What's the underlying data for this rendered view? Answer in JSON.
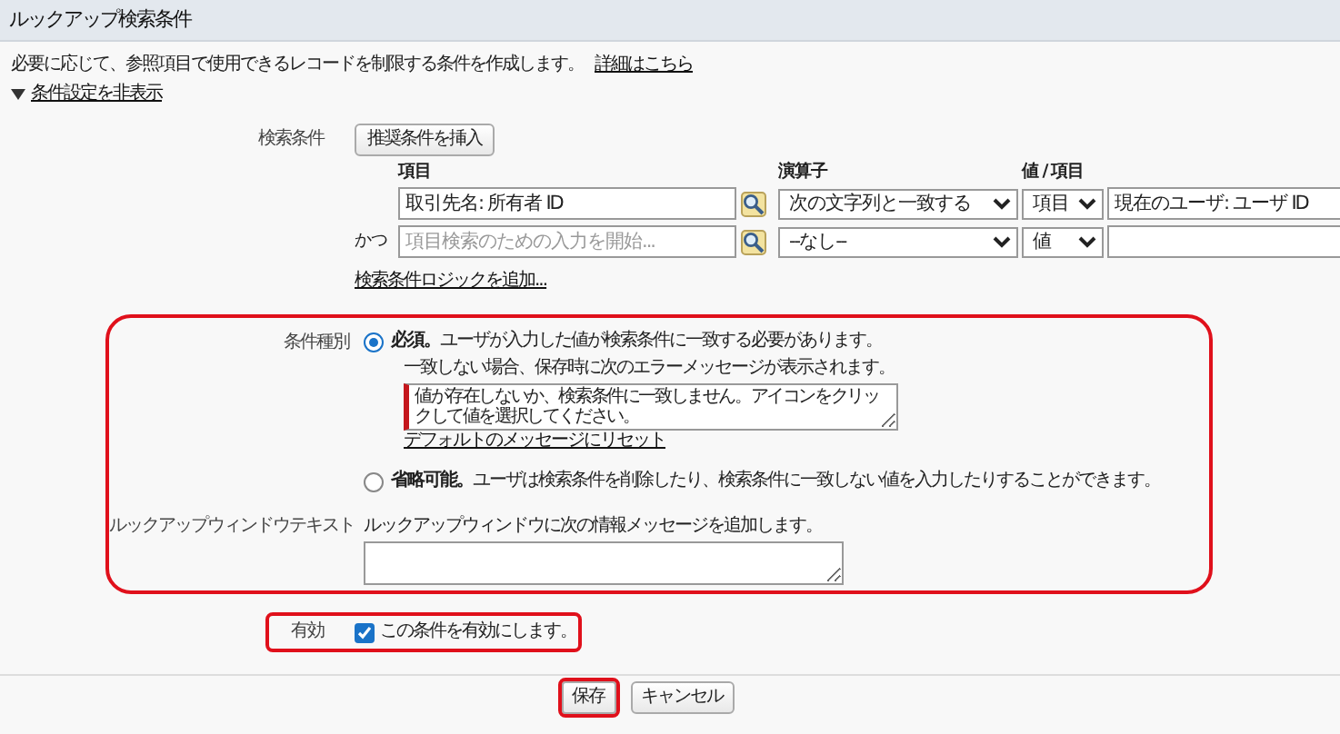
{
  "section_title": "ルックアップ検索条件",
  "description": "必要に応じて、参照項目で使用できるレコードを制限する条件を作成します。",
  "help_link": "詳細はこちら",
  "toggle": {
    "label": "条件設定を非表示",
    "expanded": true
  },
  "criteria": {
    "label": "検索条件",
    "insert_button": "推奨条件を挿入",
    "columns": [
      "項目",
      "演算子",
      "値 / 項目"
    ],
    "rows": [
      {
        "field": {
          "value": "取引先名: 所有者 ID"
        },
        "operator": "次の文字列と一致する",
        "value_type": "項目",
        "value": "現在のユーザ: ユーザ ID"
      },
      {
        "connector": "かつ",
        "field": {
          "placeholder": "項目検索のための入力を開始..."
        },
        "operator": "--なし--",
        "value_type": "値"
      }
    ],
    "logic_link": "検索条件ロジックを追加..."
  },
  "settings": {
    "highlighted": true,
    "filter_type": {
      "label": "条件種別",
      "options": [
        {
          "kind": "required",
          "text": "**必須。**ユーザが入力した値が検索条件に一致する必要があります。",
          "selected": true,
          "error_prompt": "一致しない場合、保存時に次のエラーメッセージが表示されます。",
          "error_message": "値が存在しないか、検索条件に一致しません。アイコンをクリックして値を選択してください。",
          "reset_link": "デフォルトのメッセージにリセット"
        },
        {
          "kind": "optional",
          "text": "**省略可能。**ユーザは検索条件を削除したり、検索条件に一致しない値を入力したりすることができます。",
          "selected": false
        }
      ]
    },
    "lookup_text": {
      "label": "ルックアップウィンドウテキスト",
      "prompt": "ルックアップウィンドウに次の情報メッセージを追加します。"
    }
  },
  "active": {
    "label": "有効",
    "highlighted": true,
    "checkbox_label": "この条件を有効にします。",
    "checked": true
  },
  "buttons": [
    {
      "label": "保存",
      "highlighted": true
    },
    {
      "label": "キャンセル",
      "highlighted": false
    }
  ]
}
